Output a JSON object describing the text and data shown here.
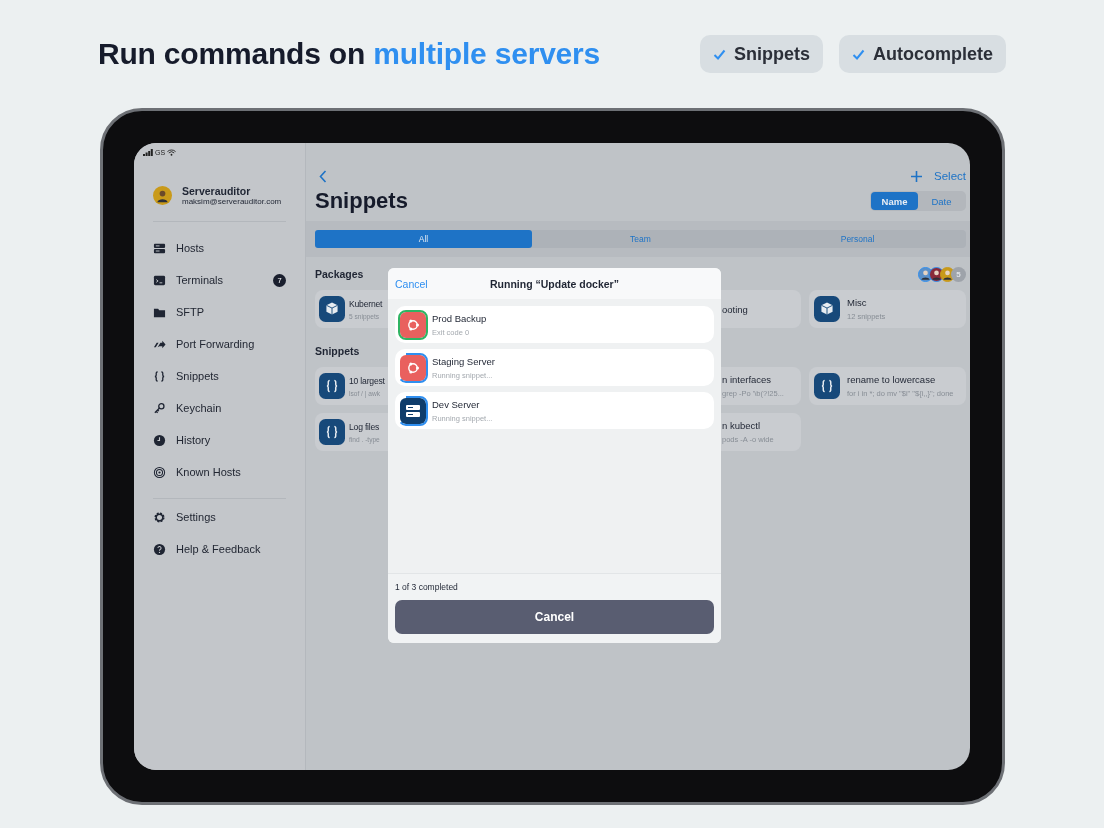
{
  "headline": {
    "text": "Run commands on",
    "highlight": "multiple servers"
  },
  "feature_chips": [
    {
      "label": "Snippets",
      "checked": true
    },
    {
      "label": "Autocomplete",
      "checked": true
    }
  ],
  "status_bar": {
    "carrier": "GS"
  },
  "sidebar": {
    "profile": {
      "name": "Serverauditor",
      "email": "maksim@serverauditor.com"
    },
    "items": [
      {
        "label": "Hosts"
      },
      {
        "label": "Terminals",
        "badge": "7"
      },
      {
        "label": "SFTP"
      },
      {
        "label": "Port Forwarding"
      },
      {
        "label": "Snippets"
      },
      {
        "label": "Keychain"
      },
      {
        "label": "History"
      },
      {
        "label": "Known Hosts"
      }
    ],
    "footer_items": [
      {
        "label": "Settings"
      },
      {
        "label": "Help & Feedback"
      }
    ]
  },
  "nav": {
    "action": "Select"
  },
  "title": "Snippets",
  "sort": [
    {
      "label": "Name",
      "selected": true
    },
    {
      "label": "Date",
      "selected": false
    }
  ],
  "filter_tabs": [
    {
      "label": "All",
      "selected": true
    },
    {
      "label": "Team",
      "selected": false
    },
    {
      "label": "Personal",
      "selected": false
    }
  ],
  "packages_heading": "Packages",
  "team_members_extra": "5",
  "snippets_heading": "Snippets",
  "card_rows": [
    {
      "left": {
        "kind": "package",
        "title": "Kubernet",
        "subtitle": "5 snippets"
      },
      "right": {
        "title": "ooting"
      },
      "full": {
        "kind": "package",
        "title": "Misc",
        "subtitle": "12 snippets"
      }
    },
    {
      "left": {
        "kind": "snippet",
        "title": "10 largest",
        "subtitle": "lsof / | awk"
      },
      "right": {
        "title": "n interfaces",
        "subtitle": "grep -Po '\\b(?!25..."
      },
      "full": {
        "kind": "snippet",
        "title": "rename to lowercase",
        "subtitle": "for i in *; do mv \"$i\" \"${i,,}\"; done"
      }
    },
    {
      "left": {
        "kind": "snippet",
        "title": "Log files",
        "subtitle": "find . -type"
      },
      "right": {
        "title": "n kubectl",
        "subtitle": "pods -A -o wide"
      }
    }
  ],
  "modal": {
    "cancel": "Cancel",
    "title": "Running “Update docker”",
    "hosts": [
      {
        "name": "Prod Backup",
        "status_text": "Exit code 0",
        "kind": "ubuntu",
        "completed": true
      },
      {
        "name": "Staging Server",
        "status_text": "Running snippet...",
        "kind": "ubuntu",
        "completed": false
      },
      {
        "name": "Dev Server",
        "status_text": "Running snippet...",
        "kind": "server",
        "completed": false
      }
    ],
    "progress": "1 of 3 completed",
    "button": "Cancel"
  }
}
